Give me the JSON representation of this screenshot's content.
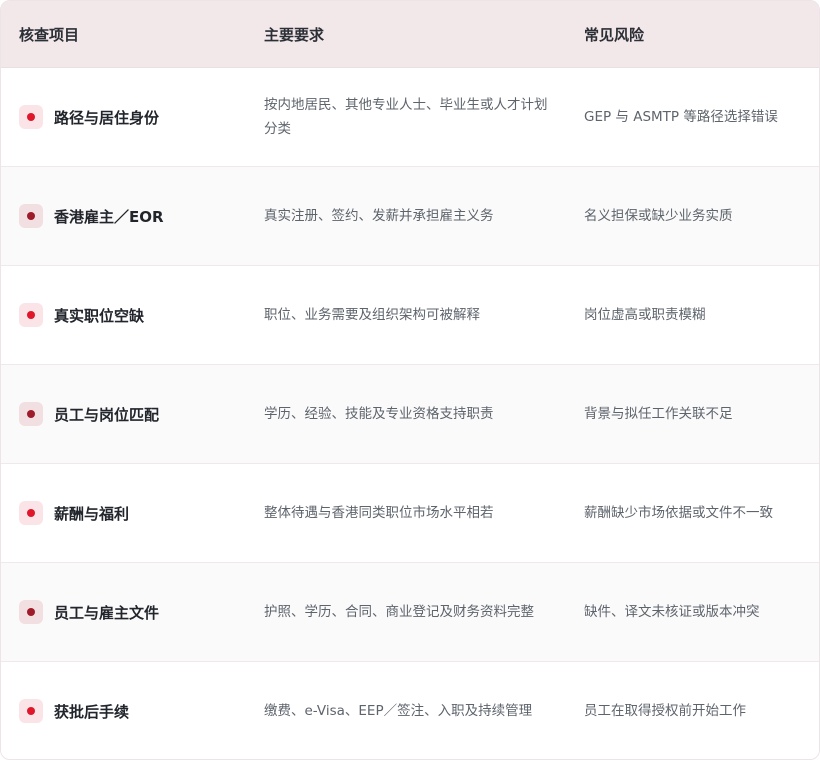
{
  "header": {
    "col_item": "核查项目",
    "col_requirement": "主要要求",
    "col_risk": "常见风险"
  },
  "rows": [
    {
      "item": "路径与居住身份",
      "requirement": "按内地居民、其他专业人士、毕业生或人才计划分类",
      "risk": "GEP 与 ASMTP 等路径选择错误",
      "marker": "red"
    },
    {
      "item": "香港雇主／EOR",
      "requirement": "真实注册、签约、发薪并承担雇主义务",
      "risk": "名义担保或缺少业务实质",
      "marker": "dark"
    },
    {
      "item": "真实职位空缺",
      "requirement": "职位、业务需要及组织架构可被解释",
      "risk": "岗位虚高或职责模糊",
      "marker": "red"
    },
    {
      "item": "员工与岗位匹配",
      "requirement": "学历、经验、技能及专业资格支持职责",
      "risk": "背景与拟任工作关联不足",
      "marker": "dark"
    },
    {
      "item": "薪酬与福利",
      "requirement": "整体待遇与香港同类职位市场水平相若",
      "risk": "薪酬缺少市场依据或文件不一致",
      "marker": "red"
    },
    {
      "item": "员工与雇主文件",
      "requirement": "护照、学历、合同、商业登记及财务资料完整",
      "risk": "缺件、译文未核证或版本冲突",
      "marker": "dark"
    },
    {
      "item": "获批后手续",
      "requirement": "缴费、e-Visa、EEP／签注、入职及持续管理",
      "risk": "员工在取得授权前开始工作",
      "marker": "red"
    }
  ],
  "colors": {
    "header_bg": "#f2e7e9",
    "marker_red": "#e0162b",
    "marker_dark": "#9e1b2a"
  }
}
